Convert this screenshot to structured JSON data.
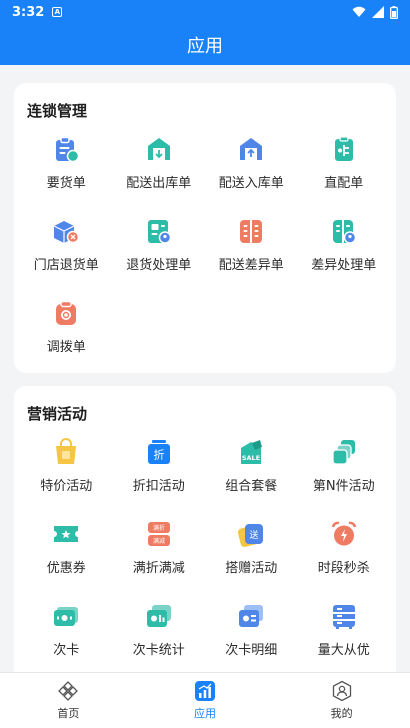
{
  "status": {
    "time": "3:32",
    "notif_glyph": "A"
  },
  "header": {
    "title": "应用"
  },
  "sections": [
    {
      "title": "连锁管理",
      "items": [
        {
          "label": "要货单",
          "icon": "clipboard-icon"
        },
        {
          "label": "配送出库单",
          "icon": "warehouse-out-icon"
        },
        {
          "label": "配送入库单",
          "icon": "warehouse-in-icon"
        },
        {
          "label": "直配单",
          "icon": "direct-delivery-icon"
        },
        {
          "label": "门店退货单",
          "icon": "return-box-icon"
        },
        {
          "label": "退货处理单",
          "icon": "return-process-icon"
        },
        {
          "label": "配送差异单",
          "icon": "difference-icon"
        },
        {
          "label": "差异处理单",
          "icon": "difference-process-icon"
        },
        {
          "label": "调拨单",
          "icon": "transfer-icon"
        }
      ]
    },
    {
      "title": "营销活动",
      "items": [
        {
          "label": "特价活动",
          "icon": "special-price-icon"
        },
        {
          "label": "折扣活动",
          "icon": "discount-icon"
        },
        {
          "label": "组合套餐",
          "icon": "combo-sale-icon"
        },
        {
          "label": "第N件活动",
          "icon": "nth-item-icon"
        },
        {
          "label": "优惠券",
          "icon": "coupon-icon"
        },
        {
          "label": "满折满减",
          "icon": "full-reduction-icon"
        },
        {
          "label": "搭赠活动",
          "icon": "gift-icon"
        },
        {
          "label": "时段秒杀",
          "icon": "alarm-clock-icon"
        },
        {
          "label": "次卡",
          "icon": "times-card-icon"
        },
        {
          "label": "次卡统计",
          "icon": "card-stats-icon"
        },
        {
          "label": "次卡明细",
          "icon": "card-detail-icon"
        },
        {
          "label": "量大从优",
          "icon": "bulk-discount-icon"
        }
      ]
    }
  ],
  "tabs": [
    {
      "label": "首页",
      "icon": "home-icon",
      "active": false
    },
    {
      "label": "应用",
      "icon": "apps-icon",
      "active": true
    },
    {
      "label": "我的",
      "icon": "profile-icon",
      "active": false
    }
  ],
  "colors": {
    "primary": "#1a82f8",
    "teal": "#2dbca8",
    "blue": "#4f86e8",
    "orange": "#ee7b62",
    "yellow": "#f6c543"
  },
  "icon_glyphs": {
    "discount": "折",
    "combo_sale": "SALE",
    "full_off_1": "满折",
    "full_off_2": "满减",
    "gift": "送"
  }
}
